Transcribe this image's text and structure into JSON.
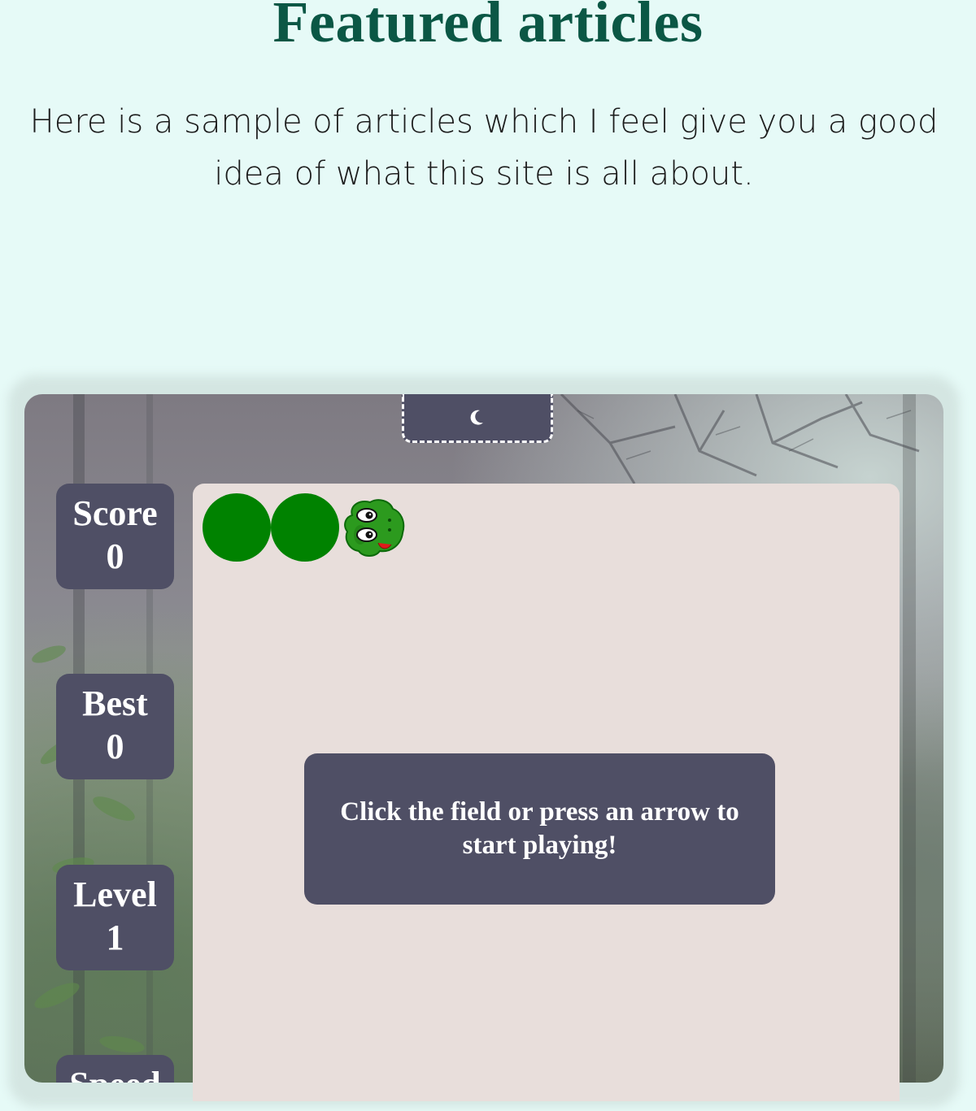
{
  "section": {
    "title": "Featured articles",
    "intro": "Here is a sample of articles which I feel give you a good idea of what this site is all about."
  },
  "game": {
    "theme_toggle_icon": "moon-icon",
    "stats": [
      {
        "label": "Score",
        "value": "0"
      },
      {
        "label": "Best",
        "value": "0"
      },
      {
        "label": "Level",
        "value": "1"
      },
      {
        "label": "Speed",
        "value": ""
      }
    ],
    "snake": {
      "body_segments": 2,
      "head_icon": "snake-head-icon"
    },
    "start_message": "Click the field or press an arrow to start playing!",
    "colors": {
      "panel": "#4f4f65",
      "field": "#e8dedb",
      "snake": "#008200",
      "heading": "#0b5745"
    }
  }
}
